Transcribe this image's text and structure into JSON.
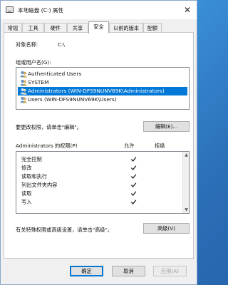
{
  "window": {
    "title": "本地磁盘 (C:) 属性",
    "close_glyph": "✕"
  },
  "tabs": [
    {
      "label": "常规"
    },
    {
      "label": "工具"
    },
    {
      "label": "硬件"
    },
    {
      "label": "共享"
    },
    {
      "label": "安全",
      "active": true
    },
    {
      "label": "以前的版本"
    },
    {
      "label": "配额"
    }
  ],
  "security": {
    "object_name_label": "对象名称:",
    "object_name_value": "C:\\",
    "groups_label": "组或用户名(G):",
    "groups": [
      {
        "label": "Authenticated Users",
        "selected": false
      },
      {
        "label": "SYSTEM",
        "selected": false
      },
      {
        "label": "Administrators (WIN-DFS9NUNV69K\\Administrators)",
        "selected": true
      },
      {
        "label": "Users (WIN-DFS9NUNV69K\\Users)",
        "selected": false
      }
    ],
    "edit_hint": "要更改权限，请单击\"编辑\"。",
    "edit_button": "编辑(E)...",
    "permissions_label": "Administrators 的权限(P)",
    "allow_header": "允许",
    "deny_header": "拒绝",
    "permissions": [
      {
        "name": "完全控制",
        "allow": true,
        "deny": false
      },
      {
        "name": "修改",
        "allow": true,
        "deny": false
      },
      {
        "name": "读取和执行",
        "allow": true,
        "deny": false
      },
      {
        "name": "列出文件夹内容",
        "allow": true,
        "deny": false
      },
      {
        "name": "读取",
        "allow": true,
        "deny": false
      },
      {
        "name": "写入",
        "allow": true,
        "deny": false
      }
    ],
    "advanced_hint": "有关特殊权限或高级设置，请单击\"高级\"。",
    "advanced_button": "高级(V)"
  },
  "footer": {
    "ok": "确定",
    "cancel": "取消",
    "apply": "应用(A)"
  },
  "colors": {
    "selection": "#0078d7",
    "desktop": "#2b6fb8"
  }
}
